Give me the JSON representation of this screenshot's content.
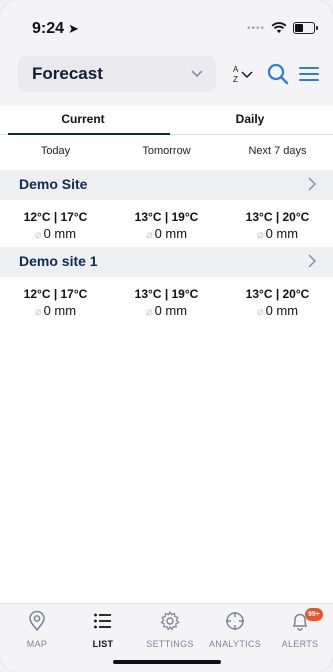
{
  "status_bar": {
    "time": "9:24",
    "location_arrow": "➤"
  },
  "header": {
    "forecast_label": "Forecast"
  },
  "tabs": [
    {
      "label": "Current",
      "active": true
    },
    {
      "label": "Daily",
      "active": false
    }
  ],
  "periods": [
    "Today",
    "Tomorrow",
    "Next 7 days"
  ],
  "sites": [
    {
      "name": "Demo Site",
      "cells": [
        {
          "temp": "12°C | 17°C",
          "rain": "0  mm"
        },
        {
          "temp": "13°C | 19°C",
          "rain": "0  mm"
        },
        {
          "temp": "13°C | 20°C",
          "rain": "0  mm"
        }
      ]
    },
    {
      "name": "Demo site 1",
      "cells": [
        {
          "temp": "12°C | 17°C",
          "rain": "0  mm"
        },
        {
          "temp": "13°C | 19°C",
          "rain": "0  mm"
        },
        {
          "temp": "13°C | 20°C",
          "rain": "0  mm"
        }
      ]
    }
  ],
  "bottom_nav": {
    "map": "MAP",
    "list": "LIST",
    "settings": "SETTINGS",
    "analytics": "ANALYTICS",
    "alerts": "ALERTS",
    "alerts_badge": "99+"
  },
  "colors": {
    "accent": "#2e7fd6",
    "navy": "#0f2b4c",
    "badge": "#e8552d"
  }
}
